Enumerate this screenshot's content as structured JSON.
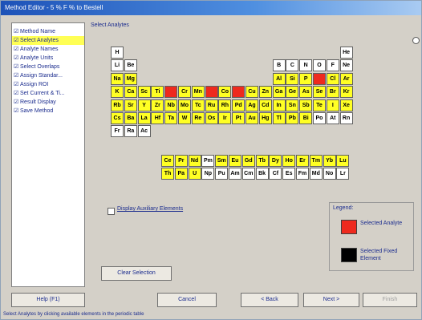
{
  "title": "Method Editor - 5 % F % to Bestell",
  "nav": {
    "items": [
      {
        "label": "Method Name",
        "selected": false
      },
      {
        "label": "Select Analytes",
        "selected": true
      },
      {
        "label": "Analyte Names",
        "selected": false
      },
      {
        "label": "Analyte Units",
        "selected": false
      },
      {
        "label": "Select Overlaps",
        "selected": false
      },
      {
        "label": "Assign Standar...",
        "selected": false
      },
      {
        "label": "Assign ROI",
        "selected": false
      },
      {
        "label": "Set Current & Ti...",
        "selected": false
      },
      {
        "label": "Result Display",
        "selected": false
      },
      {
        "label": "Save Method",
        "selected": false
      }
    ]
  },
  "group_title": "Select Analytes",
  "periodic_table": {
    "main_rows": [
      [
        [
          "H",
          "w"
        ],
        null,
        null,
        null,
        null,
        null,
        null,
        null,
        null,
        null,
        null,
        null,
        null,
        null,
        null,
        null,
        null,
        [
          "He",
          "w"
        ]
      ],
      [
        [
          "Li",
          "w"
        ],
        [
          "Be",
          "w"
        ],
        null,
        null,
        null,
        null,
        null,
        null,
        null,
        null,
        null,
        null,
        [
          "B",
          "w"
        ],
        [
          "C",
          "w"
        ],
        [
          "N",
          "w"
        ],
        [
          "O",
          "w"
        ],
        [
          "F",
          "w"
        ],
        [
          "Ne",
          "w"
        ]
      ],
      [
        [
          "Na",
          "y"
        ],
        [
          "Mg",
          "y"
        ],
        null,
        null,
        null,
        null,
        null,
        null,
        null,
        null,
        null,
        null,
        [
          "Al",
          "y"
        ],
        [
          "Si",
          "y"
        ],
        [
          "P",
          "y"
        ],
        [
          "S",
          "s"
        ],
        [
          "Cl",
          "y"
        ],
        [
          "Ar",
          "y"
        ]
      ],
      [
        [
          "K",
          "y"
        ],
        [
          "Ca",
          "y"
        ],
        [
          "Sc",
          "y"
        ],
        [
          "Ti",
          "y"
        ],
        [
          "V",
          "s"
        ],
        [
          "Cr",
          "y"
        ],
        [
          "Mn",
          "y"
        ],
        [
          "Fe",
          "s"
        ],
        [
          "Co",
          "y"
        ],
        [
          "Ni",
          "s"
        ],
        [
          "Cu",
          "y"
        ],
        [
          "Zn",
          "y"
        ],
        [
          "Ga",
          "y"
        ],
        [
          "Ge",
          "y"
        ],
        [
          "As",
          "y"
        ],
        [
          "Se",
          "y"
        ],
        [
          "Br",
          "y"
        ],
        [
          "Kr",
          "y"
        ]
      ],
      [
        [
          "Rb",
          "y"
        ],
        [
          "Sr",
          "y"
        ],
        [
          "Y",
          "y"
        ],
        [
          "Zr",
          "y"
        ],
        [
          "Nb",
          "y"
        ],
        [
          "Mo",
          "y"
        ],
        [
          "Tc",
          "y"
        ],
        [
          "Ru",
          "y"
        ],
        [
          "Rh",
          "y"
        ],
        [
          "Pd",
          "y"
        ],
        [
          "Ag",
          "y"
        ],
        [
          "Cd",
          "y"
        ],
        [
          "In",
          "y"
        ],
        [
          "Sn",
          "y"
        ],
        [
          "Sb",
          "y"
        ],
        [
          "Te",
          "y"
        ],
        [
          "I",
          "y"
        ],
        [
          "Xe",
          "y"
        ]
      ],
      [
        [
          "Cs",
          "y"
        ],
        [
          "Ba",
          "y"
        ],
        [
          "La",
          "y"
        ],
        [
          "Hf",
          "y"
        ],
        [
          "Ta",
          "y"
        ],
        [
          "W",
          "y"
        ],
        [
          "Re",
          "y"
        ],
        [
          "Os",
          "y"
        ],
        [
          "Ir",
          "y"
        ],
        [
          "Pt",
          "y"
        ],
        [
          "Au",
          "y"
        ],
        [
          "Hg",
          "y"
        ],
        [
          "Tl",
          "y"
        ],
        [
          "Pb",
          "y"
        ],
        [
          "Bi",
          "y"
        ],
        [
          "Po",
          "w"
        ],
        [
          "At",
          "w"
        ],
        [
          "Rn",
          "w"
        ]
      ],
      [
        [
          "Fr",
          "w"
        ],
        [
          "Ra",
          "w"
        ],
        [
          "Ac",
          "w"
        ]
      ]
    ],
    "f_rows": [
      [
        [
          "Ce",
          "y"
        ],
        [
          "Pr",
          "y"
        ],
        [
          "Nd",
          "y"
        ],
        [
          "Pm",
          "w"
        ],
        [
          "Sm",
          "y"
        ],
        [
          "Eu",
          "y"
        ],
        [
          "Gd",
          "y"
        ],
        [
          "Tb",
          "y"
        ],
        [
          "Dy",
          "y"
        ],
        [
          "Ho",
          "y"
        ],
        [
          "Er",
          "y"
        ],
        [
          "Tm",
          "y"
        ],
        [
          "Yb",
          "y"
        ],
        [
          "Lu",
          "y"
        ]
      ],
      [
        [
          "Th",
          "y"
        ],
        [
          "Pa",
          "y"
        ],
        [
          "U",
          "y"
        ],
        [
          "Np",
          "w"
        ],
        [
          "Pu",
          "w"
        ],
        [
          "Am",
          "w"
        ],
        [
          "Cm",
          "w"
        ],
        [
          "Bk",
          "w"
        ],
        [
          "Cf",
          "w"
        ],
        [
          "Es",
          "w"
        ],
        [
          "Fm",
          "w"
        ],
        [
          "Md",
          "w"
        ],
        [
          "No",
          "w"
        ],
        [
          "Lr",
          "w"
        ]
      ]
    ]
  },
  "aux_checkbox_label": "Display Auxiliary Elements",
  "legend": {
    "title": "Legend:",
    "selected_label": "Selected Analyte",
    "fixed_label": "Selected Fixed Element"
  },
  "buttons": {
    "clear_selection": "Clear Selection",
    "help": "Help (F1)",
    "cancel": "Cancel",
    "back": "< Back",
    "next": "Next >",
    "finish": "Finish"
  },
  "status_text": "Select Analytes by clicking available elements in the periodic table",
  "colors": {
    "available": "#ffff24",
    "selected": "#ee2a1e",
    "fixed": "#000000",
    "nav_highlight": "#ffff55"
  }
}
